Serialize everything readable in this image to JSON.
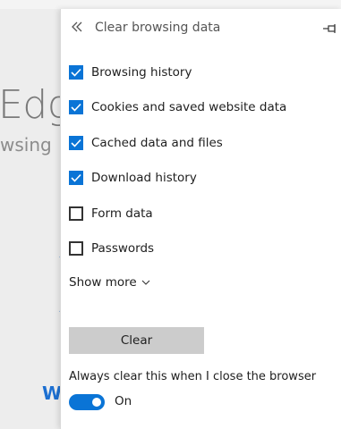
{
  "background": {
    "big_text": "Edge",
    "small_text": "wsing",
    "bottom_letter": "W"
  },
  "panel": {
    "title": "Clear browsing data",
    "back_icon": "double-chevron-left-icon",
    "pin_icon": "pin-icon",
    "options": [
      {
        "label": "Browsing history",
        "checked": true
      },
      {
        "label": "Cookies and saved website data",
        "checked": true
      },
      {
        "label": "Cached data and files",
        "checked": true
      },
      {
        "label": "Download history",
        "checked": true
      },
      {
        "label": "Form data",
        "checked": false
      },
      {
        "label": "Passwords",
        "checked": false
      }
    ],
    "show_more_label": "Show more",
    "clear_button_label": "Clear",
    "always_clear_label": "Always clear this when I close the browser",
    "toggle_state_label": "On",
    "toggle_on": true
  },
  "colors": {
    "accent": "#0a74d6",
    "button_bg": "#cccccc"
  }
}
